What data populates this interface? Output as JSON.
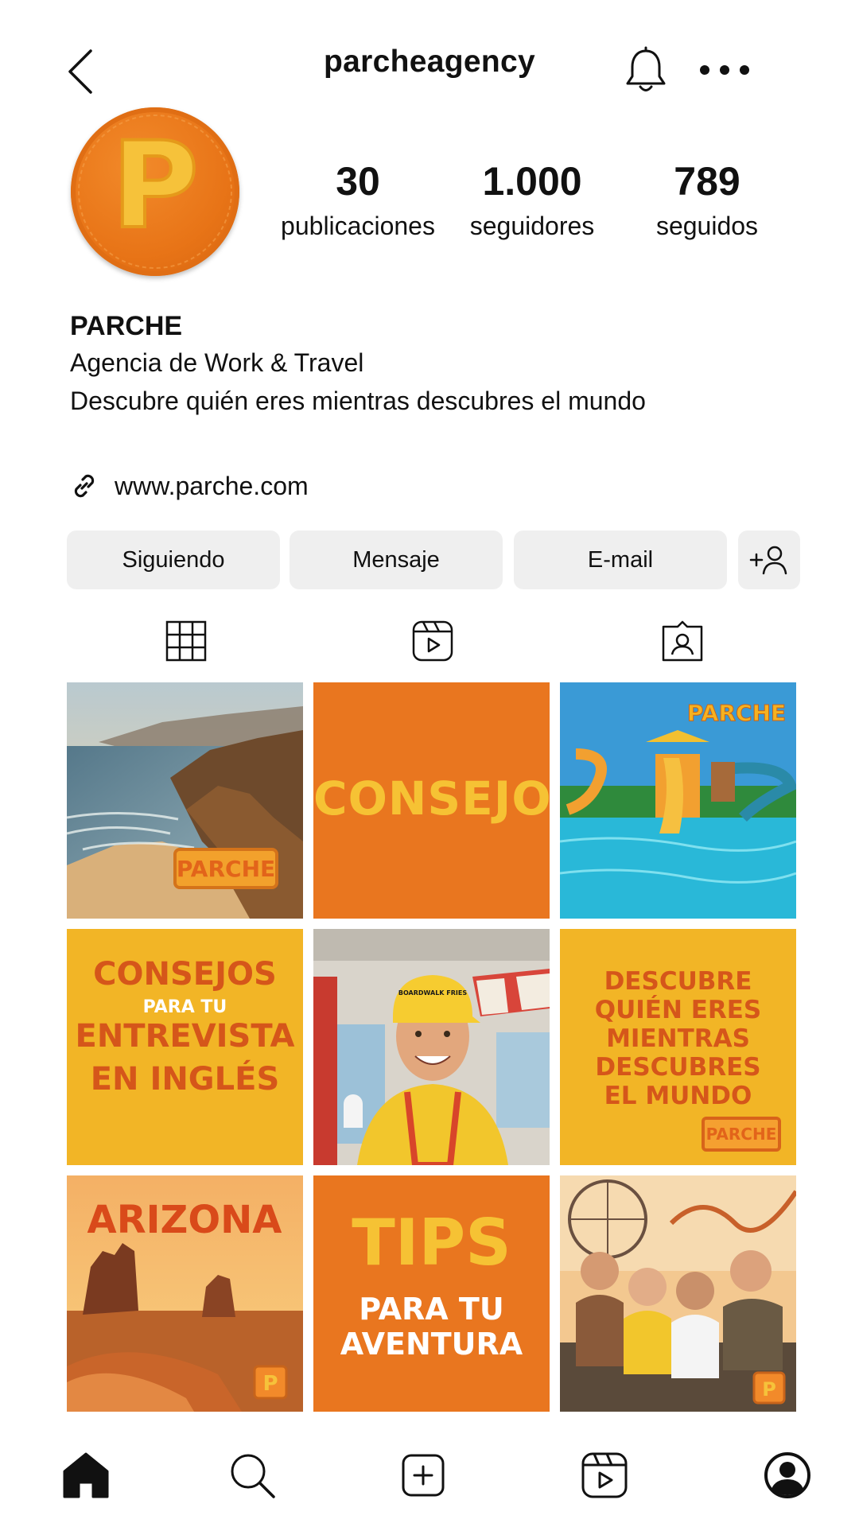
{
  "header": {
    "username": "parcheagency",
    "back_icon": "chevron-left-icon",
    "bell_icon": "bell-icon",
    "more_icon": "more-horizontal-icon"
  },
  "profile": {
    "avatar_letter": "P",
    "stats": [
      {
        "value": "30",
        "label": "publicaciones"
      },
      {
        "value": "1.000",
        "label": "seguidores"
      },
      {
        "value": "789",
        "label": "seguidos"
      }
    ],
    "name": "PARCHE",
    "bio_lines": [
      "Agencia de Work & Travel",
      "Descubre quién eres mientras descubres el mundo"
    ],
    "link_icon": "link-icon",
    "link": "www.parche.com"
  },
  "actions": {
    "following": "Siguiendo",
    "message": "Mensaje",
    "email": "E-mail",
    "add_person_icon": "add-person-icon"
  },
  "tabs": [
    {
      "icon": "grid-icon"
    },
    {
      "icon": "reels-icon"
    },
    {
      "icon": "tagged-icon"
    }
  ],
  "posts": [
    {
      "kind": "photo",
      "subject": "coastline",
      "badge": "PARCHE"
    },
    {
      "kind": "text",
      "lines": [
        "CONSEJO"
      ]
    },
    {
      "kind": "photo",
      "subject": "waterpark",
      "badge": "PARCHE"
    },
    {
      "kind": "text",
      "lines": [
        "CONSEJOS",
        "PARA TU",
        "ENTREVISTA",
        "EN INGLÉS"
      ]
    },
    {
      "kind": "photo",
      "subject": "worker",
      "cap_text": "BOARDWALK FRIES"
    },
    {
      "kind": "text",
      "lines": [
        "DESCUBRE",
        "QUIÉN ERES",
        "MIENTRAS",
        "DESCUBRES",
        "EL MUNDO"
      ],
      "badge": "PARCHE"
    },
    {
      "kind": "photo",
      "subject": "desert",
      "title": "ARIZONA",
      "badge": "P"
    },
    {
      "kind": "text",
      "lines": [
        "TIPS",
        "PARA TU",
        "AVENTURA"
      ]
    },
    {
      "kind": "photo",
      "subject": "friends",
      "badge": "P"
    }
  ],
  "colors": {
    "orange": "#e9761f",
    "yellow": "#f2b526",
    "dark_orange": "#d5561a",
    "button_bg": "#efefef"
  },
  "nav": [
    {
      "icon": "home-icon"
    },
    {
      "icon": "search-icon"
    },
    {
      "icon": "create-icon"
    },
    {
      "icon": "reels-icon"
    },
    {
      "icon": "profile-icon"
    }
  ]
}
